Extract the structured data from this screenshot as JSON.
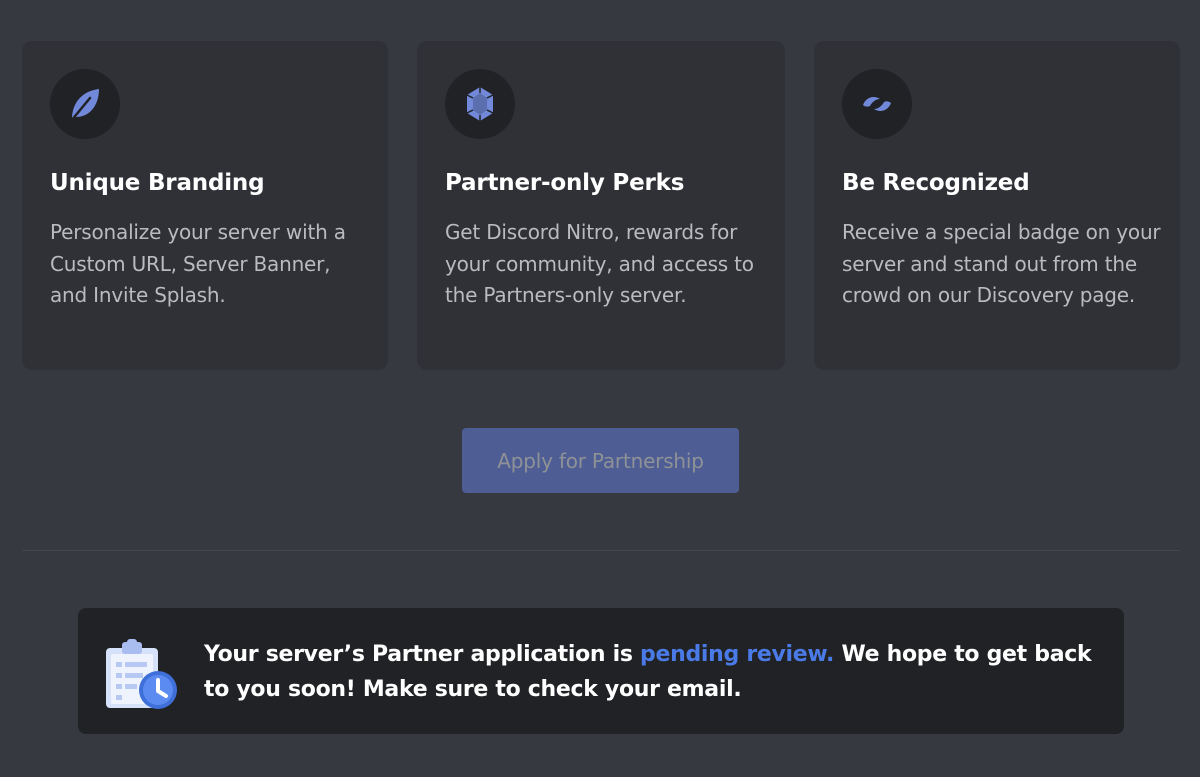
{
  "cards": [
    {
      "icon": "leaf-icon",
      "title": "Unique Branding",
      "description": "Personalize your server with a Custom URL, Server Banner, and Invite Splash."
    },
    {
      "icon": "gem-icon",
      "title": "Partner-only Perks",
      "description": "Get Discord Nitro, rewards for your community, and access to the Partners-only server."
    },
    {
      "icon": "partner-badge-icon",
      "title": "Be Recognized",
      "description": "Receive a special badge on your server and stand out from the crowd on our Discovery page."
    }
  ],
  "apply_button": {
    "label": "Apply for Partnership",
    "disabled": true
  },
  "notice": {
    "icon": "clipboard-clock-icon",
    "text_before": "Your server’s Partner application is ",
    "link_text": "pending review.",
    "text_after": " We hope to get back to you soon! Make sure to check your email."
  },
  "colors": {
    "background": "#36393f",
    "card": "#2f3136",
    "icon_circle": "#202225",
    "accent_icon": "#7289da",
    "button_disabled": "#4e5d94",
    "link": "#4a7ae6"
  }
}
